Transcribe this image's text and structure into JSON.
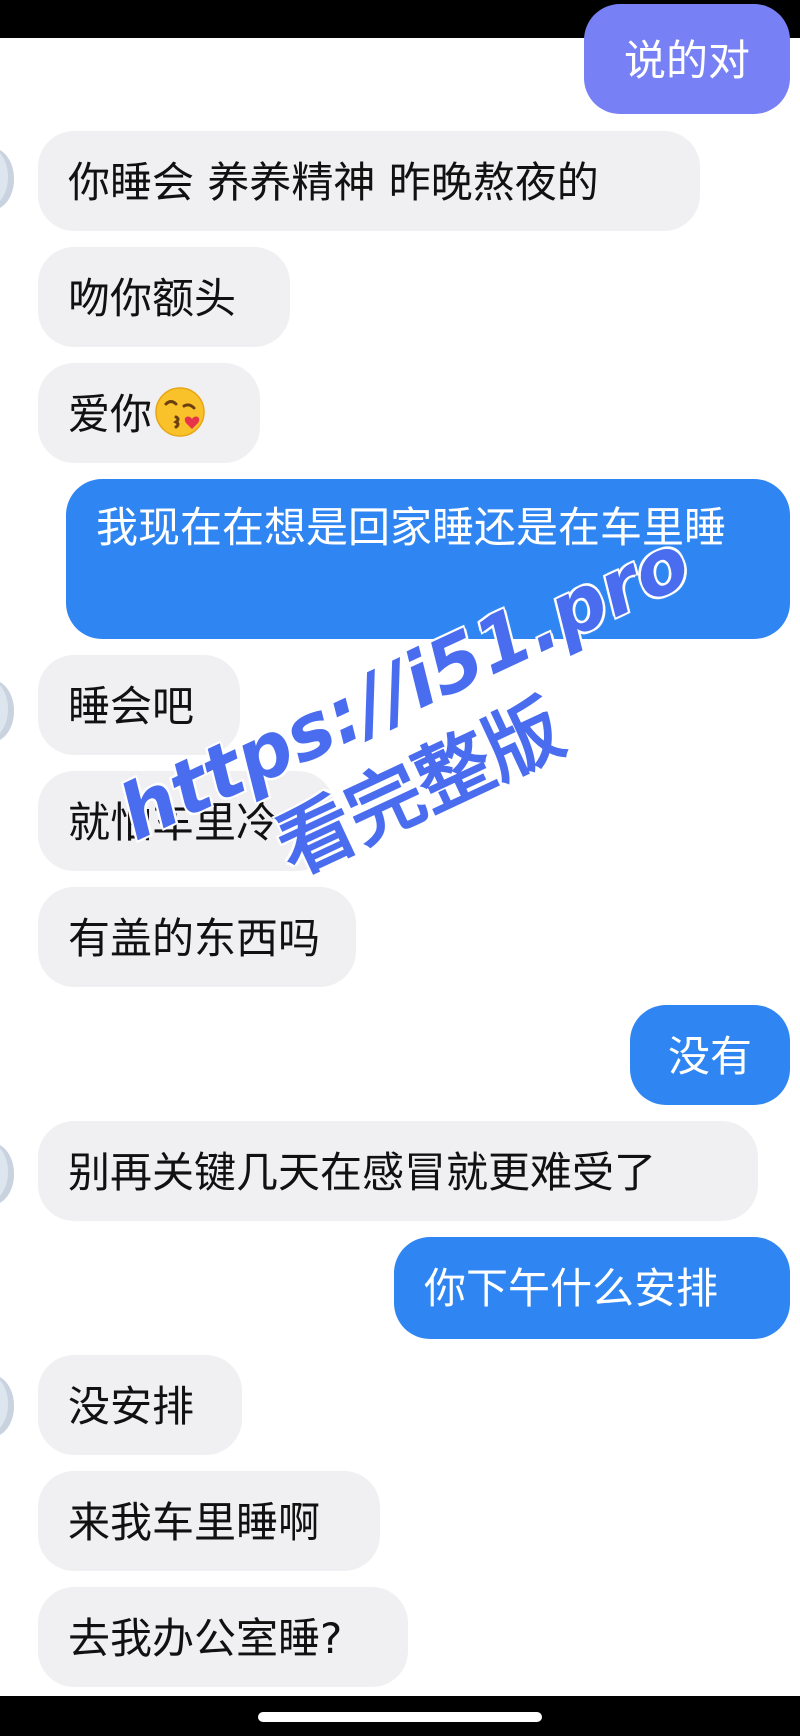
{
  "messages": [
    {
      "text": "说的对"
    },
    {
      "text": "你睡会 养养精神 昨晚熬夜的"
    },
    {
      "text": "吻你额头"
    },
    {
      "text": "爱你"
    },
    {
      "text": "我现在在想是回家睡还是在车里睡"
    },
    {
      "text": "睡会吧"
    },
    {
      "text": "就怕车里冷"
    },
    {
      "text": "有盖的东西吗"
    },
    {
      "text": "没有"
    },
    {
      "text": "别再关键几天在感冒就更难受了"
    },
    {
      "text": "你下午什么安排"
    },
    {
      "text": "没安排"
    },
    {
      "text": "来我车里睡啊"
    },
    {
      "text": "去我办公室睡?"
    }
  ],
  "icons": {
    "emoji": "face-blowing-a-kiss-icon",
    "avatar": "contact-avatar"
  },
  "colors": {
    "incoming_bubble": "#f0f0f2",
    "outgoing_bubble_purple": "#7880f5",
    "outgoing_bubble_blue": "#2f86f2",
    "watermark": "#4a6df0"
  },
  "watermark": {
    "url": "https://i51.pro",
    "text": "看完整版"
  }
}
